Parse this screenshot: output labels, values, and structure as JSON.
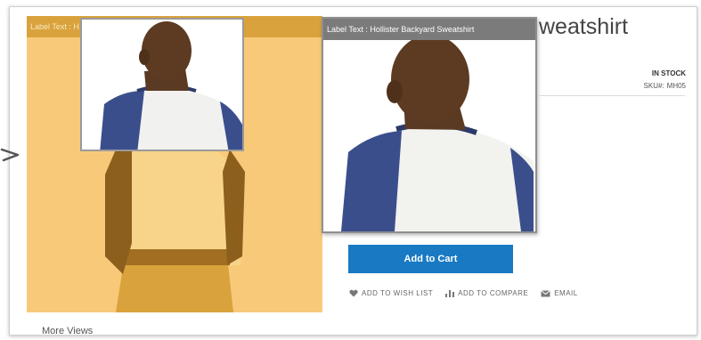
{
  "product": {
    "title_fragment": "weatshirt",
    "stock_status": "IN STOCK",
    "sku_label": "SKU#:",
    "sku_value": "MH05"
  },
  "main_image": {
    "label_text": "Label Text : H"
  },
  "zoom": {
    "label_text": "Label Text : Hollister Backyard Sweatshirt"
  },
  "actions": {
    "add_to_cart": "Add to Cart",
    "wish_list": "ADD TO WISH LIST",
    "compare": "ADD TO COMPARE",
    "email": "EMAIL"
  },
  "gallery": {
    "more_views": "More Views"
  },
  "colors": {
    "primary_button": "#1979c3",
    "main_bg": "#f9c97a",
    "label_bar": "#d9a23c",
    "zoom_label": "#7b7b7b",
    "sleeve": "#3b4e8c"
  },
  "icons": [
    "arrow-icon",
    "heart-icon",
    "bar-chart-icon",
    "envelope-icon"
  ]
}
